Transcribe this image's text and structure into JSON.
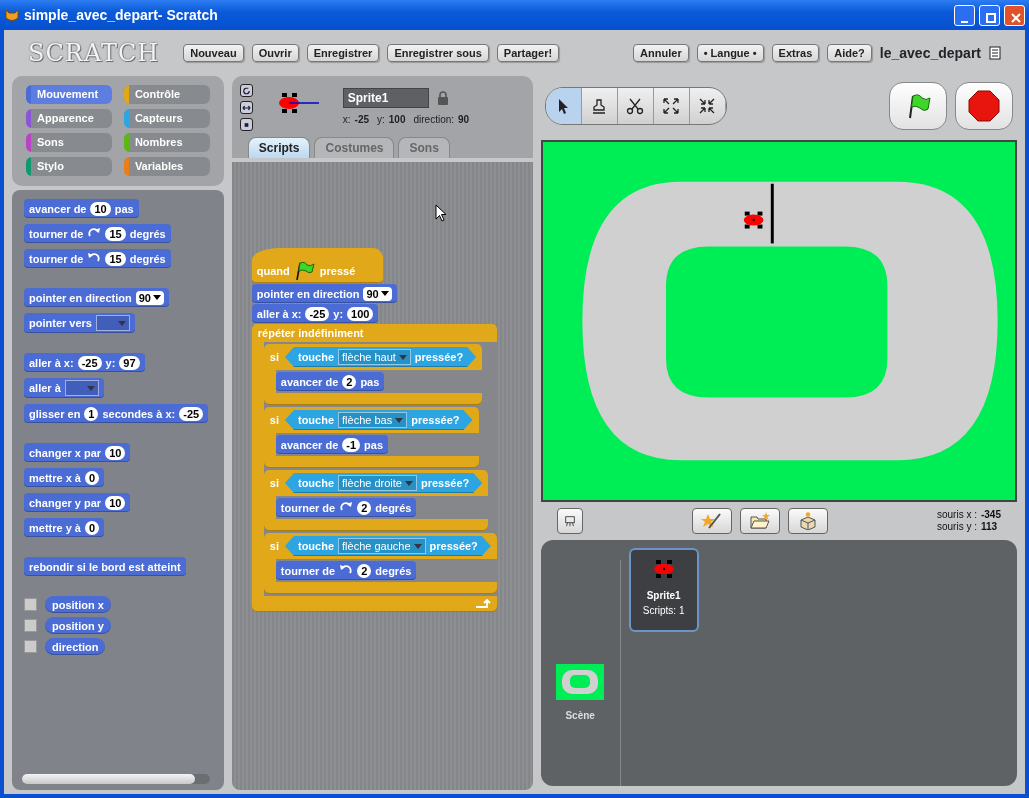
{
  "window": {
    "title": "simple_avec_depart- Scratch"
  },
  "logo": "SCRATCH",
  "menu": [
    {
      "label": "Nouveau"
    },
    {
      "label": "Ouvrir"
    },
    {
      "label": "Enregistrer"
    },
    {
      "label": "Enregistrer sous"
    },
    {
      "label": "Partager!"
    },
    {
      "label": "Annuler"
    },
    {
      "label": "• Langue •"
    },
    {
      "label": "Extras"
    },
    {
      "label": "Aide?"
    }
  ],
  "project_name": "le_avec_depart",
  "categories": [
    {
      "label": "Mouvement",
      "color": "#4a6cd4",
      "selected": true
    },
    {
      "label": "Contrôle",
      "color": "#e1a91a",
      "selected": false
    },
    {
      "label": "Apparence",
      "color": "#8a55d7",
      "selected": false
    },
    {
      "label": "Capteurs",
      "color": "#2ca5e2",
      "selected": false
    },
    {
      "label": "Sons",
      "color": "#bb42c3",
      "selected": false
    },
    {
      "label": "Nombres",
      "color": "#5cb712",
      "selected": false
    },
    {
      "label": "Stylo",
      "color": "#0e9a6c",
      "selected": false
    },
    {
      "label": "Variables",
      "color": "#ee7d16",
      "selected": false
    }
  ],
  "palette": [
    [
      {
        "kind": "motion",
        "parts": [
          {
            "kind": "text",
            "text": "avancer de"
          },
          {
            "kind": "number",
            "text": "10"
          },
          {
            "kind": "text",
            "text": "pas"
          }
        ]
      },
      {
        "kind": "motion",
        "parts": [
          {
            "kind": "text",
            "text": "tourner de"
          },
          {
            "kind": "cw"
          },
          {
            "kind": "number",
            "text": "15"
          },
          {
            "kind": "text",
            "text": "degrés"
          }
        ]
      },
      {
        "kind": "motion",
        "parts": [
          {
            "kind": "text",
            "text": "tourner de"
          },
          {
            "kind": "ccw"
          },
          {
            "kind": "number",
            "text": "15"
          },
          {
            "kind": "text",
            "text": "degrés"
          }
        ]
      }
    ],
    [
      {
        "kind": "motion",
        "parts": [
          {
            "kind": "text",
            "text": "pointer en direction"
          },
          {
            "kind": "menu",
            "text": "90"
          }
        ]
      },
      {
        "kind": "motion",
        "parts": [
          {
            "kind": "text",
            "text": "pointer vers"
          },
          {
            "kind": "slot"
          }
        ]
      }
    ],
    [
      {
        "kind": "motion",
        "parts": [
          {
            "kind": "text",
            "text": "aller à x:"
          },
          {
            "kind": "number",
            "text": "-25"
          },
          {
            "kind": "text",
            "text": "y:"
          },
          {
            "kind": "number",
            "text": "97"
          }
        ]
      },
      {
        "kind": "motion",
        "parts": [
          {
            "kind": "text",
            "text": "aller à"
          },
          {
            "kind": "slot"
          }
        ]
      },
      {
        "kind": "motion",
        "parts": [
          {
            "kind": "text",
            "text": "glisser en"
          },
          {
            "kind": "number",
            "text": "1"
          },
          {
            "kind": "text",
            "text": "secondes à x:"
          },
          {
            "kind": "number",
            "text": "-25"
          }
        ]
      }
    ],
    [
      {
        "kind": "motion",
        "parts": [
          {
            "kind": "text",
            "text": "changer x par"
          },
          {
            "kind": "number",
            "text": "10"
          }
        ]
      },
      {
        "kind": "motion",
        "parts": [
          {
            "kind": "text",
            "text": "mettre x à"
          },
          {
            "kind": "number",
            "text": "0"
          }
        ]
      },
      {
        "kind": "motion",
        "parts": [
          {
            "kind": "text",
            "text": "changer y par"
          },
          {
            "kind": "number",
            "text": "10"
          }
        ]
      },
      {
        "kind": "motion",
        "parts": [
          {
            "kind": "text",
            "text": "mettre y à"
          },
          {
            "kind": "number",
            "text": "0"
          }
        ]
      }
    ],
    [
      {
        "kind": "motion",
        "parts": [
          {
            "kind": "text",
            "text": "rebondir si le bord est atteint"
          }
        ]
      }
    ],
    [
      {
        "kind": "reporter",
        "checked": false,
        "parts": [
          {
            "kind": "text",
            "text": "position x"
          }
        ]
      },
      {
        "kind": "reporter",
        "checked": false,
        "parts": [
          {
            "kind": "text",
            "text": "position y"
          }
        ]
      },
      {
        "kind": "reporter",
        "checked": false,
        "parts": [
          {
            "kind": "text",
            "text": "direction"
          }
        ]
      }
    ]
  ],
  "sprite": {
    "name": "Sprite1",
    "info": [
      {
        "label": "x:",
        "value": "-25"
      },
      {
        "label": "y:",
        "value": "100"
      },
      {
        "label": "direction:",
        "value": "90"
      }
    ]
  },
  "tabs": [
    {
      "label": "Scripts",
      "selected": true
    },
    {
      "label": "Costumes",
      "selected": false
    },
    {
      "label": "Sons",
      "selected": false
    }
  ],
  "script": [
    {
      "kind": "hat",
      "parts": [
        {
          "kind": "text",
          "text": "quand"
        },
        {
          "kind": "flag"
        },
        {
          "kind": "text",
          "text": "pressé"
        }
      ]
    },
    {
      "kind": "motion",
      "parts": [
        {
          "kind": "text",
          "text": "pointer en direction"
        },
        {
          "kind": "menu",
          "text": "90"
        }
      ]
    },
    {
      "kind": "motion",
      "parts": [
        {
          "kind": "text",
          "text": "aller à x:"
        },
        {
          "kind": "number",
          "text": "-25"
        },
        {
          "kind": "text",
          "text": "y:"
        },
        {
          "kind": "number",
          "text": "100"
        }
      ]
    },
    {
      "kind": "forever",
      "parts": [
        {
          "kind": "text",
          "text": "répéter indéfiniment"
        }
      ],
      "children": [
        {
          "kind": "if",
          "parts": [
            {
              "kind": "text",
              "text": "si"
            },
            {
              "kind": "condition",
              "parts": [
                {
                  "kind": "text",
                  "text": "touche"
                },
                {
                  "kind": "slot",
                  "text": "flèche haut"
                },
                {
                  "kind": "text",
                  "text": "pressée?"
                }
              ]
            }
          ],
          "children": [
            {
              "kind": "motion",
              "parts": [
                {
                  "kind": "text",
                  "text": "avancer de"
                },
                {
                  "kind": "number",
                  "text": "2"
                },
                {
                  "kind": "text",
                  "text": "pas"
                }
              ]
            }
          ]
        },
        {
          "kind": "if",
          "parts": [
            {
              "kind": "text",
              "text": "si"
            },
            {
              "kind": "condition",
              "parts": [
                {
                  "kind": "text",
                  "text": "touche"
                },
                {
                  "kind": "slot",
                  "text": "flèche bas"
                },
                {
                  "kind": "text",
                  "text": "pressée?"
                }
              ]
            }
          ],
          "children": [
            {
              "kind": "motion",
              "parts": [
                {
                  "kind": "text",
                  "text": "avancer de"
                },
                {
                  "kind": "number",
                  "text": "-1"
                },
                {
                  "kind": "text",
                  "text": "pas"
                }
              ]
            }
          ]
        },
        {
          "kind": "if",
          "parts": [
            {
              "kind": "text",
              "text": "si"
            },
            {
              "kind": "condition",
              "parts": [
                {
                  "kind": "text",
                  "text": "touche"
                },
                {
                  "kind": "slot",
                  "text": "flèche droite"
                },
                {
                  "kind": "text",
                  "text": "pressée?"
                }
              ]
            }
          ],
          "children": [
            {
              "kind": "motion",
              "parts": [
                {
                  "kind": "text",
                  "text": "tourner de"
                },
                {
                  "kind": "cw"
                },
                {
                  "kind": "number",
                  "text": "2"
                },
                {
                  "kind": "text",
                  "text": "degrés"
                }
              ]
            }
          ]
        },
        {
          "kind": "if",
          "parts": [
            {
              "kind": "text",
              "text": "si"
            },
            {
              "kind": "condition",
              "parts": [
                {
                  "kind": "text",
                  "text": "touche"
                },
                {
                  "kind": "slot",
                  "text": "flèche gauche"
                },
                {
                  "kind": "text",
                  "text": "pressée?"
                }
              ]
            }
          ],
          "children": [
            {
              "kind": "motion",
              "parts": [
                {
                  "kind": "text",
                  "text": "tourner de"
                },
                {
                  "kind": "ccw"
                },
                {
                  "kind": "number",
                  "text": "2"
                },
                {
                  "kind": "text",
                  "text": "degrés"
                }
              ]
            }
          ]
        }
      ]
    }
  ],
  "tools": [
    {
      "kind": "arrow",
      "selected": true
    },
    {
      "kind": "stamp",
      "selected": false
    },
    {
      "kind": "scissors",
      "selected": false
    },
    {
      "kind": "grow",
      "selected": false
    },
    {
      "kind": "shrink",
      "selected": false
    }
  ],
  "mouse": [
    {
      "label": "souris x :",
      "value": "-345"
    },
    {
      "label": "souris y :",
      "value": "113"
    }
  ],
  "stage_thumb": {
    "label": "Scène"
  },
  "sprites": [
    {
      "name": "Sprite1",
      "detail": "Scripts: 1",
      "selected": true
    }
  ]
}
